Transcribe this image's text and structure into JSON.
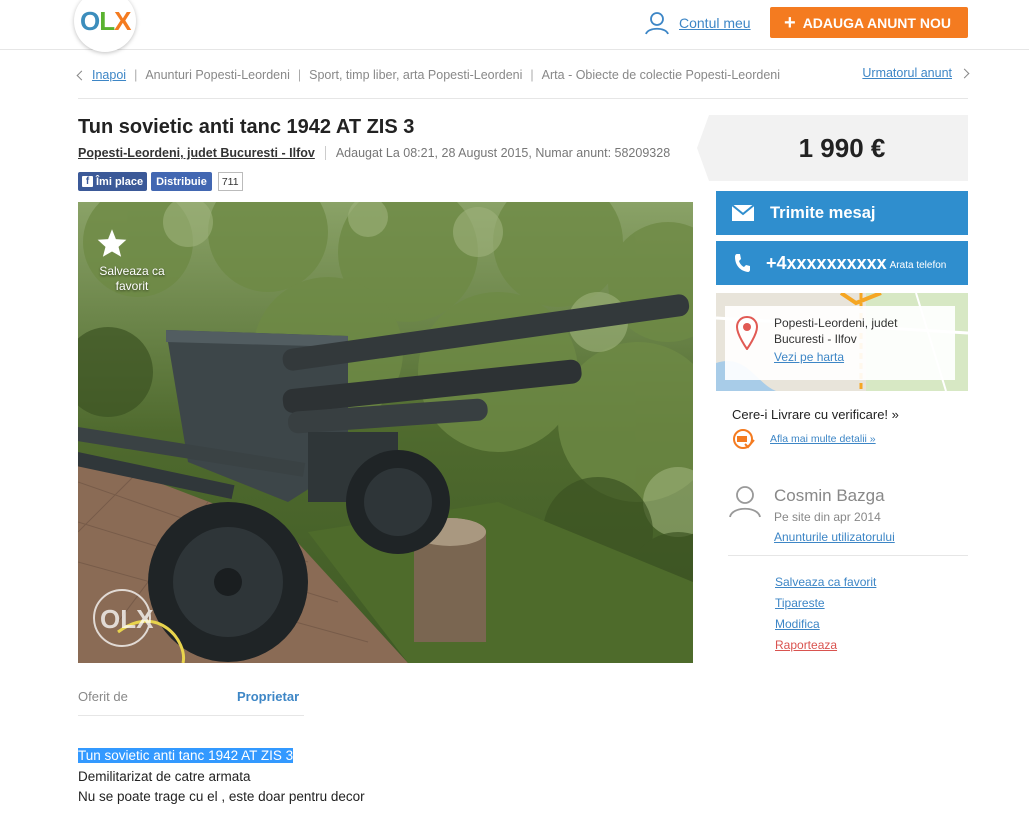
{
  "header": {
    "logo": "OLX",
    "account_label": "Contul meu",
    "post_button": "ADAUGA ANUNT NOU"
  },
  "breadcrumb": {
    "back": "Inapoi",
    "items": [
      "Anunturi Popesti-Leordeni",
      "Sport, timp liber, arta Popesti-Leordeni",
      "Arta - Obiecte de colectie Popesti-Leordeni"
    ],
    "next": "Urmatorul anunt"
  },
  "ad": {
    "title": "Tun sovietic anti tanc 1942 AT ZIS 3",
    "location": "Popesti-Leordeni, judet Bucuresti - Ilfov",
    "meta": "Adaugat La 08:21, 28 August 2015, Numar anunt: 58209328",
    "save_favorite": "Salveaza ca favorit",
    "watermark": "OLX"
  },
  "social": {
    "like": "Îmi place",
    "share": "Distribuie",
    "count": "711"
  },
  "details": {
    "offered_label": "Oferit de",
    "offered_value": "Proprietar"
  },
  "description": {
    "lines": [
      "Tun sovietic anti tanc 1942 AT ZIS 3",
      "Demilitarizat de catre armata",
      "Nu se poate trage cu el , este doar pentru decor"
    ]
  },
  "sidebar": {
    "price": "1 990 €",
    "message_button": "Trimite mesaj",
    "phone": "+4xxxxxxxxxx",
    "phone_show": "Arata telefon",
    "map_location_line1": "Popesti-Leordeni, judet",
    "map_location_line2": "Bucuresti - Ilfov",
    "map_link": "Vezi pe harta",
    "delivery_title": "Cere-i Livrare cu verificare! »",
    "delivery_link": "Afla mai multe detalii »",
    "user_name": "Cosmin Bazga",
    "user_since": "Pe site din apr 2014",
    "user_ads": "Anunturile utilizatorului",
    "actions": [
      "Salveaza ca favorit",
      "Tipareste",
      "Modifica",
      "Raporteaza"
    ]
  },
  "colors": {
    "accent_orange": "#f47b20",
    "link_blue": "#3d86c6",
    "button_blue": "#2f8ece",
    "facebook_blue": "#3b5998"
  }
}
